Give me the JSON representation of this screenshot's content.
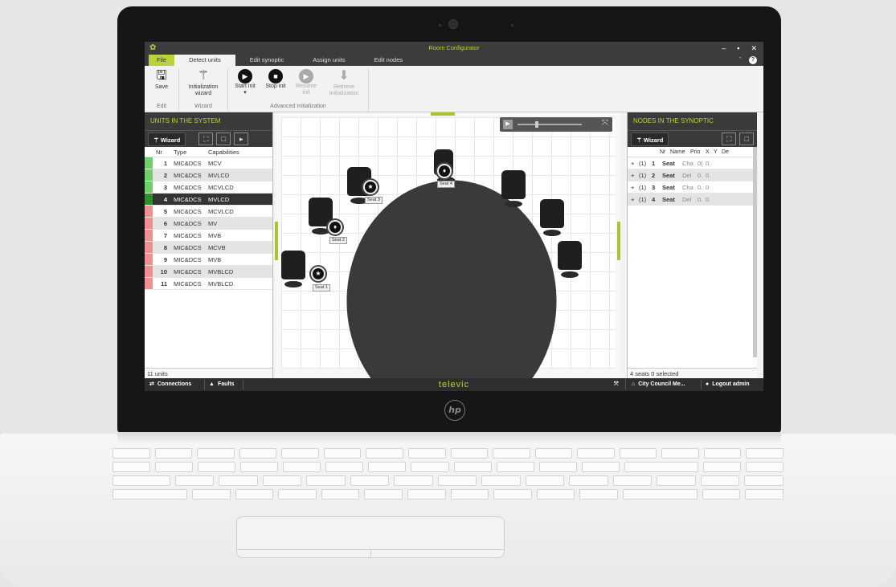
{
  "window": {
    "title": "Room Configurator"
  },
  "tabs": [
    "File",
    "Detect units",
    "Edit synoptic",
    "Assign units",
    "Edit nodes"
  ],
  "ribbon": {
    "groups": [
      {
        "name": "Edit",
        "buttons": [
          {
            "label": "Save",
            "icon": "floppy-icon"
          }
        ]
      },
      {
        "name": "Wizard",
        "buttons": [
          {
            "label": "Initialization wizard",
            "icon": "magic-wand-icon"
          }
        ]
      },
      {
        "name": "Advanced Initialization",
        "buttons": [
          {
            "label": "Start init ▾",
            "icon": "play-icon"
          },
          {
            "label": "Stop init",
            "icon": "stop-icon"
          },
          {
            "label": "Resume init",
            "icon": "resume-icon"
          },
          {
            "label": "Retrieve Initialization",
            "icon": "retrieve-icon"
          }
        ]
      }
    ]
  },
  "left_panel": {
    "title": "UNITS IN THE SYSTEM",
    "wizard_label": "Wizard",
    "columns": [
      "Nr",
      "Type",
      "Capabilities"
    ],
    "rows": [
      {
        "nr": "1",
        "type": "MIC&DCS",
        "cap": "MCV"
      },
      {
        "nr": "2",
        "type": "MIC&DCS",
        "cap": "MVLCD"
      },
      {
        "nr": "3",
        "type": "MIC&DCS",
        "cap": "MCVLCD"
      },
      {
        "nr": "4",
        "type": "MIC&DCS",
        "cap": "MVLCD"
      },
      {
        "nr": "5",
        "type": "MIC&DCS",
        "cap": "MCVLCD"
      },
      {
        "nr": "6",
        "type": "MIC&DCS",
        "cap": "MV"
      },
      {
        "nr": "7",
        "type": "MIC&DCS",
        "cap": "MVB"
      },
      {
        "nr": "8",
        "type": "MIC&DCS",
        "cap": "MCVB"
      },
      {
        "nr": "9",
        "type": "MIC&DCS",
        "cap": "MVB"
      },
      {
        "nr": "10",
        "type": "MIC&DCS",
        "cap": "MVBLCD"
      },
      {
        "nr": "11",
        "type": "MIC&DCS",
        "cap": "MVBLCD"
      }
    ],
    "footer": "11 units"
  },
  "synoptic": {
    "seats": [
      "Seat 1",
      "Seat 2",
      "Seat 3",
      "Seat 4"
    ]
  },
  "right_panel": {
    "title": "NODES IN THE SYNOPTIC",
    "wizard_label": "Wizard",
    "columns": [
      "Nr",
      "Name",
      "Prio",
      "X",
      "Y",
      "De"
    ],
    "rows": [
      {
        "grp": "(1)",
        "nr": "1",
        "name": "Seat",
        "prio": "Cha",
        "x": "0(",
        "y": "0."
      },
      {
        "grp": "(1)",
        "nr": "2",
        "name": "Seat",
        "prio": "Del",
        "x": "0.",
        "y": "0."
      },
      {
        "grp": "(1)",
        "nr": "3",
        "name": "Seat",
        "prio": "Cha",
        "x": "0.",
        "y": "0"
      },
      {
        "grp": "(1)",
        "nr": "4",
        "name": "Seat",
        "prio": "Del",
        "x": "0.",
        "y": "0"
      }
    ],
    "footer": "4 seats   0 selected"
  },
  "statusbar": {
    "connections": "Connections",
    "faults": "Faults",
    "brand": "televic",
    "meeting": "City Council Me...",
    "logout": "Logout admin"
  },
  "colors": {
    "accent": "#b9d43a",
    "dark": "#3a3a3a",
    "status_green": "#5cc45c",
    "status_red": "#e88a8a"
  },
  "status_colors": [
    "#6fcf6f",
    "#6fcf6f",
    "#6fcf6f",
    "#2f8f2f",
    "#f08f8f",
    "#f08f8f",
    "#f08f8f",
    "#f08f8f",
    "#f08f8f",
    "#f08f8f",
    "#f08f8f"
  ]
}
